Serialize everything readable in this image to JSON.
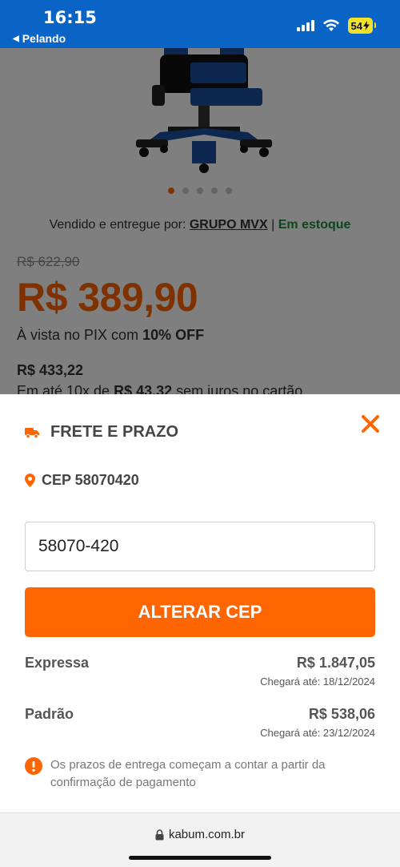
{
  "status_bar": {
    "time": "16:15",
    "back_app": "Pelando",
    "battery": "54",
    "icons": [
      "signal-icon",
      "wifi-icon",
      "battery-charging-icon"
    ]
  },
  "product": {
    "seller_prefix": "Vendido e entregue por:",
    "seller_name": "GRUPO MVX",
    "separator": "|",
    "stock": "Em estoque",
    "old_price": "R$ 622,90",
    "price": "R$ 389,90",
    "pix_text": "À vista no PIX com",
    "pix_discount": "10% OFF",
    "card_price": "R$ 433,22",
    "installments_prefix": "Em até 10x de",
    "installment_value": "R$ 43,32",
    "installments_suffix": "sem juros no cartão",
    "carousel_pages": 5,
    "carousel_active": 1
  },
  "shipping_sheet": {
    "title": "FRETE E PRAZO",
    "cep_label": "CEP 58070420",
    "cep_input_value": "58070-420",
    "change_button": "ALTERAR CEP",
    "options": [
      {
        "name": "Expressa",
        "price": "R$ 1.847,05",
        "eta": "Chegará até: 18/12/2024"
      },
      {
        "name": "Padrão",
        "price": "R$ 538,06",
        "eta": "Chegará até: 23/12/2024"
      }
    ],
    "notice": "Os prazos de entrega começam a contar a partir da confirmação de pagamento"
  },
  "browser": {
    "url": "kabum.com.br"
  },
  "colors": {
    "brand_orange": "#ff6500",
    "status_blue": "#0a64c6",
    "stock_green": "#1e8a3a"
  }
}
